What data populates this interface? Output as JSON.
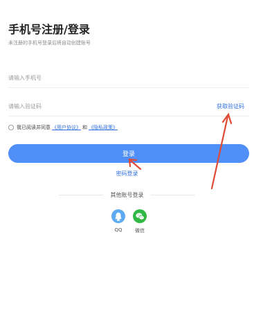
{
  "header": {
    "title": "手机号注册/登录",
    "subtitle": "未注册的手机号登录后将自动创建账号"
  },
  "form": {
    "phone_placeholder": "请输入手机号",
    "code_placeholder": "请输入验证码",
    "get_code_label": "获取验证码"
  },
  "agreement": {
    "prefix": "我已阅读并同意",
    "user_agreement": "《用户协议》",
    "and": "和",
    "privacy_policy": "《隐私政策》"
  },
  "actions": {
    "login_label": "登录",
    "password_login_label": "密码登录"
  },
  "other_login": {
    "label": "其他账号登录",
    "providers": [
      {
        "name": "QQ",
        "icon": "qq-icon",
        "color": "#5eaaf2"
      },
      {
        "name": "微信",
        "icon": "wechat-icon",
        "color": "#32b945"
      }
    ]
  },
  "annotations": {
    "arrow_color": "#e04a35"
  }
}
